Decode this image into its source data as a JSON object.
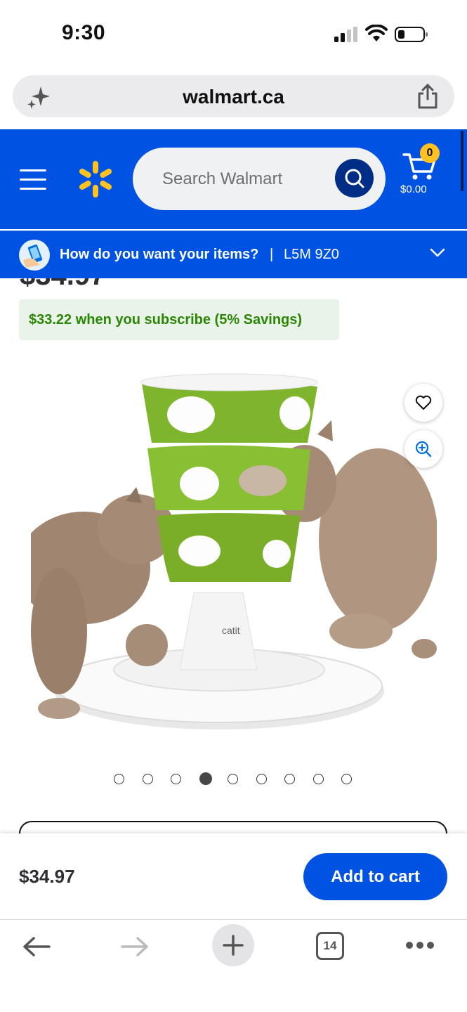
{
  "status_bar": {
    "time": "9:30"
  },
  "browser": {
    "url": "walmart.ca"
  },
  "header": {
    "search_placeholder": "Search Walmart",
    "cart_count": "0",
    "cart_total": "$0.00"
  },
  "delivery": {
    "prompt": "How do you want your items?",
    "separator": "|",
    "postal_code": "L5M 9Z0"
  },
  "product": {
    "price_partial": "$34.97",
    "subscribe_text": "$33.22 when you subscribe (5% Savings)",
    "image_brand_text": "catit",
    "carousel": {
      "total": 9,
      "active_index": 3
    }
  },
  "buy_bar": {
    "price": "$34.97",
    "add_to_cart_label": "Add to cart"
  },
  "toolbar": {
    "tab_count": "14"
  },
  "colors": {
    "walmart_blue": "#0053e2",
    "spark_yellow": "#ffc220",
    "subscribe_green": "#2a8703",
    "subscribe_bg": "#e9f3e9"
  },
  "icons": [
    "signal-icon",
    "wifi-icon",
    "battery-icon",
    "sparkle-icon",
    "share-icon",
    "menu-icon",
    "walmart-spark-icon",
    "search-icon",
    "cart-icon",
    "delivery-icon",
    "chevron-down-icon",
    "heart-icon",
    "zoom-in-icon",
    "back-arrow-icon",
    "forward-arrow-icon",
    "plus-icon",
    "tabs-icon",
    "more-icon"
  ]
}
